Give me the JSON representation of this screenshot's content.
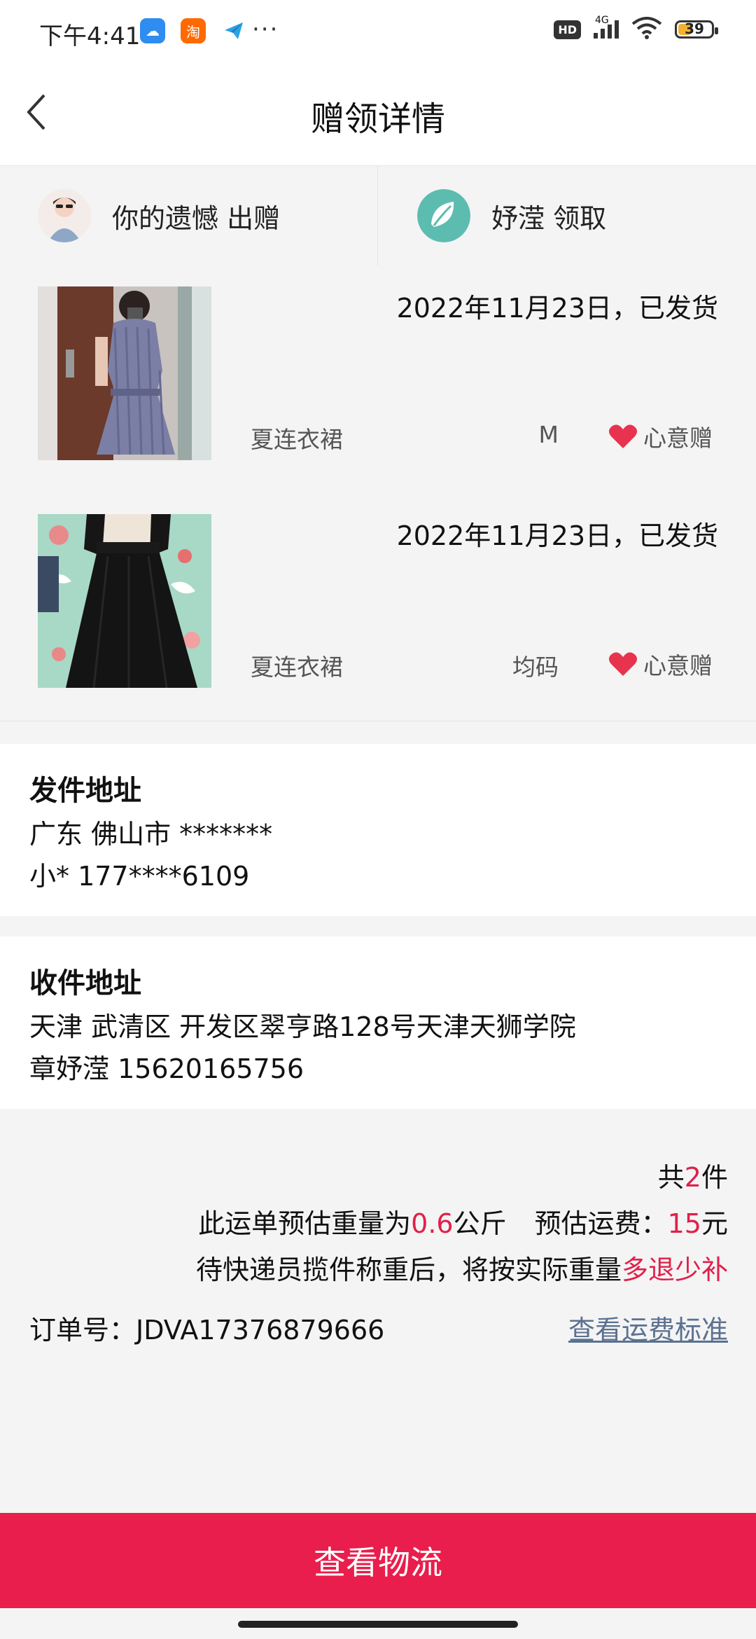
{
  "status_bar": {
    "time": "下午4:41",
    "network": "4G",
    "hd": "HD",
    "battery": "39",
    "battery_level": 0.39
  },
  "header": {
    "title": "赠领详情",
    "back_icon": "chevron-left-icon"
  },
  "users": {
    "giver": {
      "text": "你的遗憾 出赠"
    },
    "receiver": {
      "text": "妤滢 领取"
    }
  },
  "items": [
    {
      "date": "2022年11月23日，已发货",
      "name": "夏连衣裙",
      "size": "M",
      "tag": "心意赠"
    },
    {
      "date": "2022年11月23日，已发货",
      "name": "夏连衣裙",
      "size": "均码",
      "tag": "心意赠"
    }
  ],
  "sender": {
    "title": "发件地址",
    "line1": "广东 佛山市 *******",
    "line2": "小* 177****6109"
  },
  "receiver_address": {
    "title": "收件地址",
    "line1": "天津 武清区 开发区翠亨路128号天津天狮学院",
    "line2": "章妤滢 15620165756"
  },
  "summary": {
    "count_prefix": "共",
    "count": "2",
    "count_suffix": "件",
    "weight_prefix": "此运单预估重量为",
    "weight": "0.6",
    "weight_unit": "公斤",
    "fee_prefix": "预估运费：",
    "fee": "15",
    "fee_unit": "元",
    "note_prefix": "待快递员揽件称重后，将按实际重量",
    "note_highlight": "多退少补",
    "order_label": "订单号：JDVA17376879666",
    "fee_link": "查看运费标准"
  },
  "bottom_button": "查看物流",
  "colors": {
    "accent": "#e91e4c",
    "highlight": "#e0204a",
    "link": "#5b7190",
    "heart": "#e8334f"
  }
}
